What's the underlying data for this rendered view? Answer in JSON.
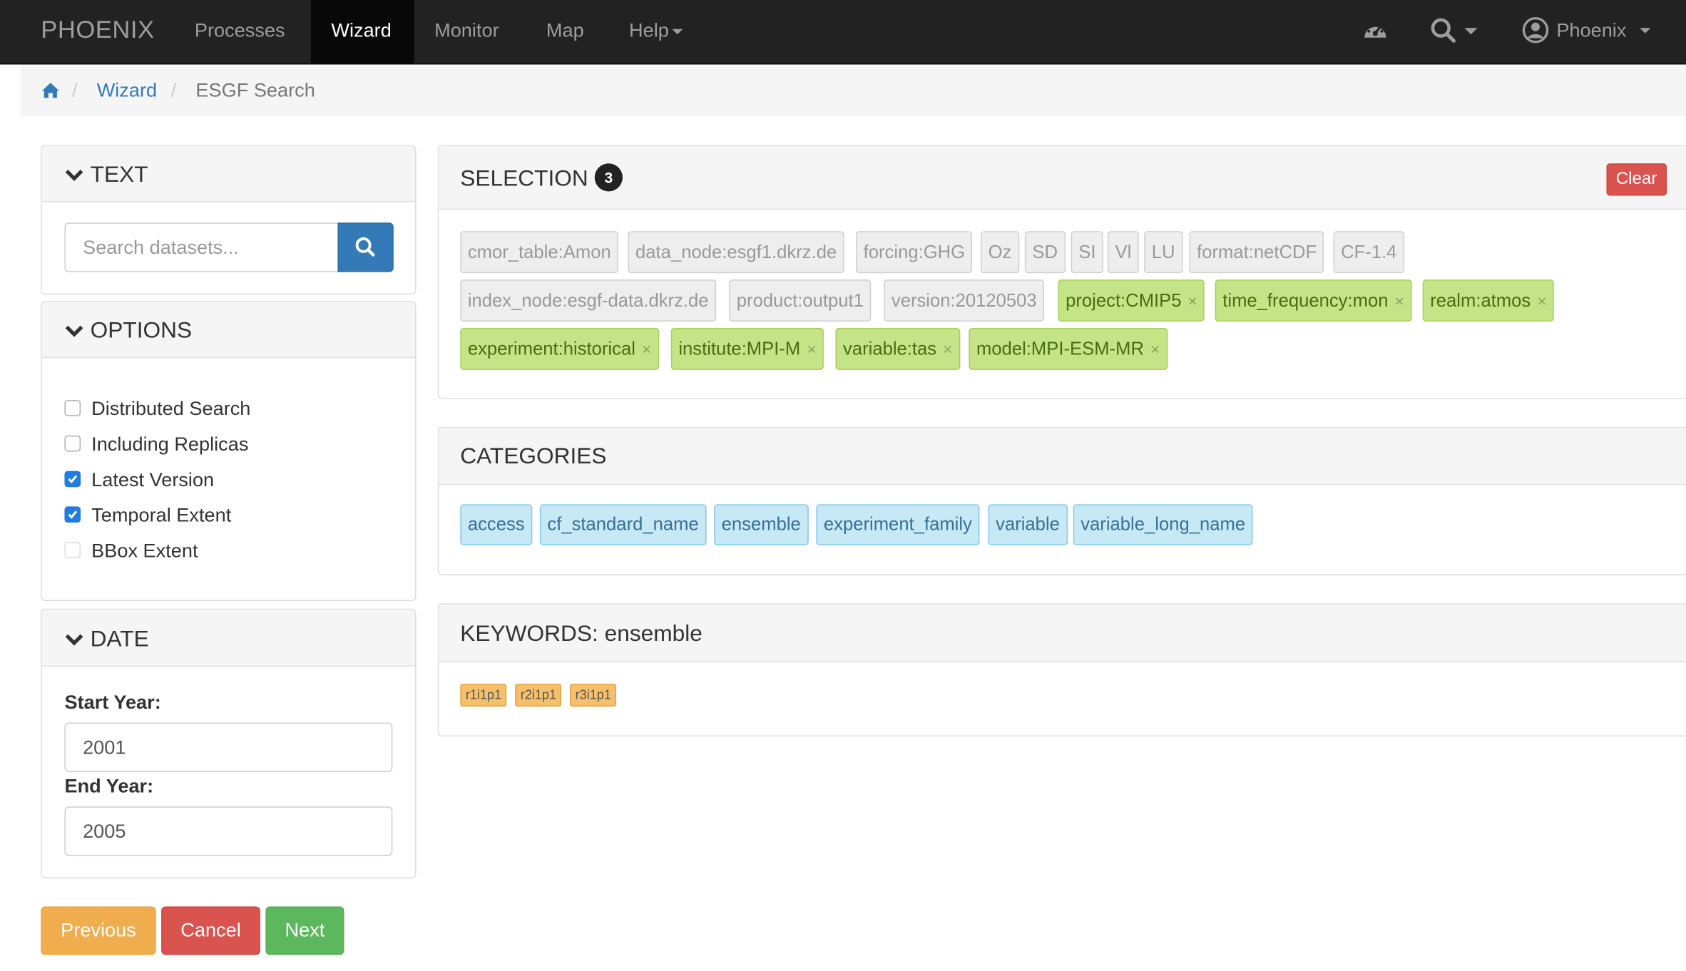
{
  "navbar": {
    "brand": "PHOENIX",
    "items": [
      {
        "label": "Processes"
      },
      {
        "label": "Wizard",
        "active": true
      },
      {
        "label": "Monitor"
      },
      {
        "label": "Map"
      },
      {
        "label": "Help"
      }
    ],
    "user": "Phoenix",
    "icons": [
      "dashboard-icon",
      "search-icon",
      "user-circle-icon"
    ]
  },
  "breadcrumb": {
    "home_icon": "home-icon",
    "separator": "/",
    "items": [
      "Wizard",
      "ESGF Search"
    ]
  },
  "text_panel": {
    "title": "TEXT",
    "search_placeholder": "Search datasets...",
    "search_icon": "search-icon"
  },
  "options_panel": {
    "title": "OPTIONS",
    "options": [
      {
        "label": "Distributed Search",
        "checked": false
      },
      {
        "label": "Including Replicas",
        "checked": false
      },
      {
        "label": "Latest Version",
        "checked": true
      },
      {
        "label": "Temporal Extent",
        "checked": true
      },
      {
        "label": "BBox Extent",
        "checked": false
      }
    ]
  },
  "date_panel": {
    "title": "DATE",
    "start_label": "Start Year:",
    "start_value": "2001",
    "end_label": "End Year:",
    "end_value": "2005"
  },
  "buttons": {
    "previous": "Previous",
    "cancel": "Cancel",
    "next": "Next"
  },
  "selection": {
    "title": "SELECTION",
    "count": "3",
    "clear_label": "Clear",
    "remove_glyph": "×",
    "facets": [
      {
        "label": "cmor_table:Amon",
        "selected": false
      },
      {
        "label": "data_node:esgf1.dkrz.de",
        "selected": false
      },
      {
        "label": "forcing:GHG",
        "selected": false
      },
      {
        "label": "Oz",
        "selected": false
      },
      {
        "label": "SD",
        "selected": false
      },
      {
        "label": "SI",
        "selected": false
      },
      {
        "label": "Vl",
        "selected": false
      },
      {
        "label": "LU",
        "selected": false
      },
      {
        "label": "format:netCDF",
        "selected": false
      },
      {
        "label": "CF-1.4",
        "selected": false
      },
      {
        "label": "index_node:esgf-data.dkrz.de",
        "selected": false
      },
      {
        "label": "product:output1",
        "selected": false
      },
      {
        "label": "version:20120503",
        "selected": false
      },
      {
        "label": "project:CMIP5",
        "selected": true
      },
      {
        "label": "time_frequency:mon",
        "selected": true
      },
      {
        "label": "realm:atmos",
        "selected": true
      },
      {
        "label": "experiment:historical",
        "selected": true
      },
      {
        "label": "institute:MPI-M",
        "selected": true
      },
      {
        "label": "variable:tas",
        "selected": true
      },
      {
        "label": "model:MPI-ESM-MR",
        "selected": true
      }
    ]
  },
  "categories": {
    "title": "CATEGORIES",
    "items": [
      "access",
      "cf_standard_name",
      "ensemble",
      "experiment_family",
      "variable",
      "variable_long_name"
    ]
  },
  "keywords": {
    "title": "KEYWORDS: ensemble",
    "items": [
      "r1i1p1",
      "r2i1p1",
      "r3i1p1"
    ]
  },
  "colors": {
    "navbar_bg": "#222222",
    "link": "#337ab7",
    "selected_facet": "#c5e488",
    "category": "#c7e9f6",
    "keyword": "#f6c06b",
    "danger": "#d9534f",
    "warning": "#f0ad4e",
    "success": "#5cb85c"
  }
}
